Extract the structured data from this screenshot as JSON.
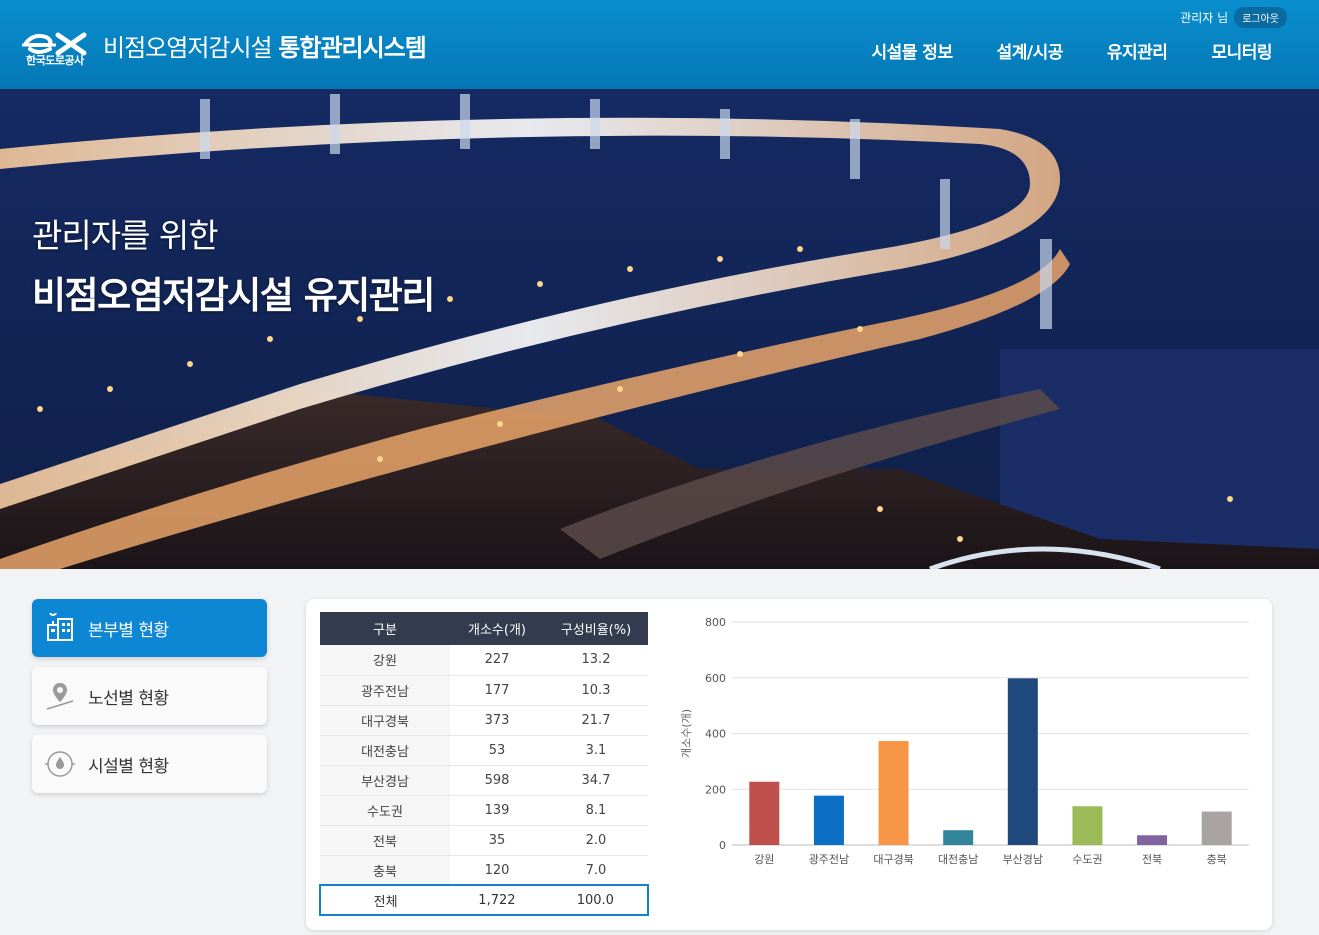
{
  "header": {
    "logo_text": "한국도로공사",
    "title_prefix": "비점오염저감시설 ",
    "title_bold": "통합관리시스템",
    "user_label": "관리자 님",
    "logout_label": "로그아웃",
    "nav": [
      "시설물 정보",
      "설계/시공",
      "유지관리",
      "모니터링"
    ]
  },
  "hero": {
    "subtitle": "관리자를 위한",
    "title": "비점오염저감시설 유지관리"
  },
  "side_menu": [
    {
      "label": "본부별 현황",
      "icon": "building-icon",
      "active": true
    },
    {
      "label": "노선별 현황",
      "icon": "map-pin-icon",
      "active": false
    },
    {
      "label": "시설별 현황",
      "icon": "water-drop-icon",
      "active": false
    }
  ],
  "table": {
    "headers": [
      "구분",
      "개소수(개)",
      "구성비율(%)"
    ],
    "rows": [
      [
        "강원",
        "227",
        "13.2"
      ],
      [
        "광주전남",
        "177",
        "10.3"
      ],
      [
        "대구경북",
        "373",
        "21.7"
      ],
      [
        "대전충남",
        "53",
        "3.1"
      ],
      [
        "부산경남",
        "598",
        "34.7"
      ],
      [
        "수도권",
        "139",
        "8.1"
      ],
      [
        "전북",
        "35",
        "2.0"
      ],
      [
        "충북",
        "120",
        "7.0"
      ]
    ],
    "total": [
      "전체",
      "1,722",
      "100.0"
    ]
  },
  "chart_data": {
    "type": "bar",
    "categories": [
      "강원",
      "광주전남",
      "대구경북",
      "대전충남",
      "부산경남",
      "수도권",
      "전북",
      "충북"
    ],
    "values": [
      227,
      177,
      373,
      53,
      598,
      139,
      35,
      120
    ],
    "colors": [
      "#c0504d",
      "#0b6fc5",
      "#f79646",
      "#31849b",
      "#1f497d",
      "#9bbb59",
      "#8064a2",
      "#aaa3a3"
    ],
    "ylabel": "개소수(개)",
    "ylim": [
      0,
      800
    ],
    "yticks": [
      "0",
      "200",
      "400",
      "600",
      "800"
    ],
    "grid": true
  },
  "colors": {
    "header": "#0883c3",
    "active_menu": "#0d86d3",
    "table_header": "#323c4e"
  }
}
